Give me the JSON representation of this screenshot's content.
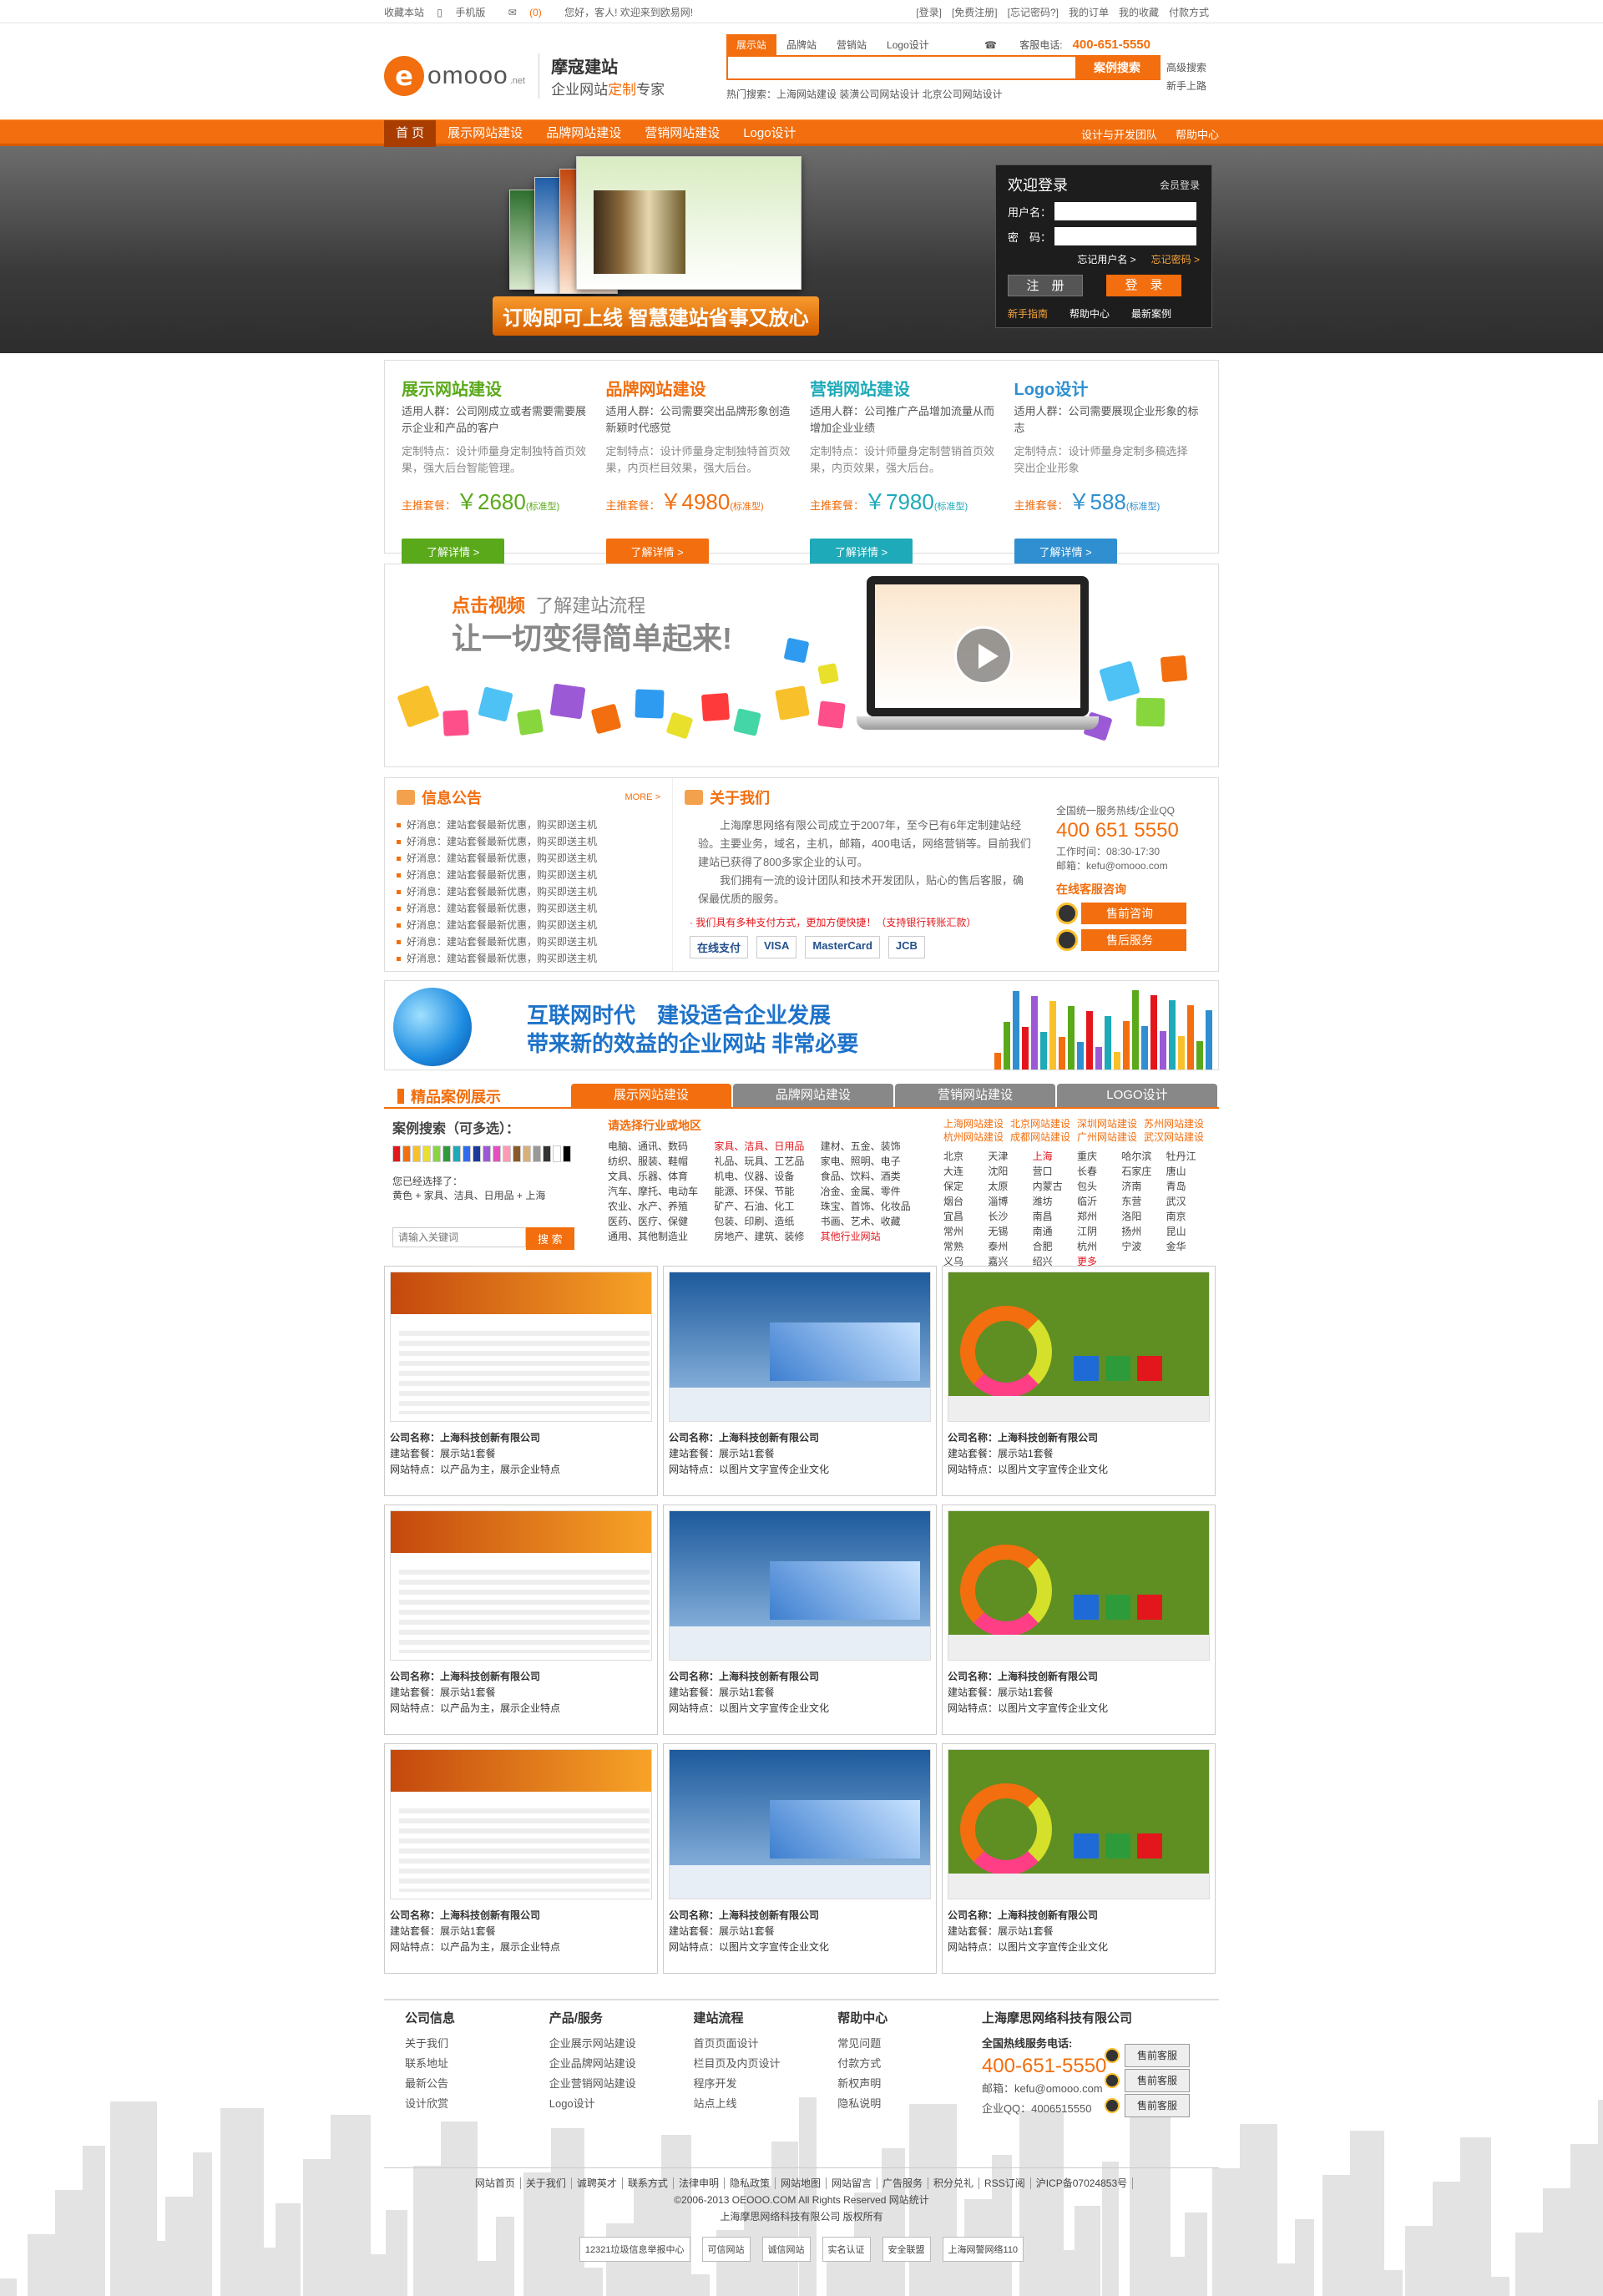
{
  "topbar": {
    "bookmark": "收藏本站",
    "mobile": "手机版",
    "msg": "(0)",
    "greeting": "您好，客人! 欢迎来到欧易网!",
    "links": [
      "[登录]",
      "[免费注册]",
      "[忘记密码?]",
      "我的订单",
      "我的收藏",
      "付款方式"
    ]
  },
  "brand": {
    "logo_letter": "e",
    "logo_word": "omooo",
    "logo_suffix": ".net",
    "slogan1": "摩寇建站",
    "slogan2a": "企业网站",
    "slogan2b": "定制",
    "slogan2c": "专家"
  },
  "search": {
    "tabs": [
      "展示站",
      "品牌站",
      "营销站",
      "Logo设计"
    ],
    "hotline_label": "客服电话:",
    "hotline": "400-651-5550",
    "placeholder": "",
    "button": "案例搜索",
    "advanced": "高级搜索",
    "newbie": "新手上路",
    "hot_words": "热门搜索：上海网站建设   装潢公司网站设计   北京公司网站设计"
  },
  "nav": {
    "items": [
      "首 页",
      "展示网站建设",
      "品牌网站建设",
      "营销网站建设",
      "Logo设计"
    ],
    "right": [
      "设计与开发团队",
      "帮助中心"
    ]
  },
  "banner": {
    "slogan": "订购即可上线 智慧建站省事又放心",
    "login": {
      "title": "欢迎登录",
      "member": "会员登录",
      "user_label": "用户名：",
      "pwd_label": "密　码：",
      "forgot_user": "忘记用户名 >",
      "forgot_pwd": "忘记密码 >",
      "register": "注　册",
      "login": "登　录",
      "guide": "新手指南",
      "help": "帮助中心",
      "latest": "最新案例"
    }
  },
  "packages": [
    {
      "title": "展示网站建设",
      "color": "#5aa91a",
      "who": "适用人群：公司刚成立或者需要需要展示企业和产品的客户",
      "feat": "定制特点：设计师量身定制独特首页效果，强大后台智能管理。",
      "label": "主推套餐：",
      "price": "￥2680",
      "std": "(标准型)",
      "btn": "了解详情 >"
    },
    {
      "title": "品牌网站建设",
      "color": "#f26e0e",
      "who": "适用人群：公司需要突出品牌形象创造新颖时代感觉",
      "feat": "定制特点：设计师量身定制独特首页效果，内页栏目效果，强大后台。",
      "label": "主推套餐：",
      "price": "￥4980",
      "std": "(标准型)",
      "btn": "了解详情 >"
    },
    {
      "title": "营销网站建设",
      "color": "#1eaab8",
      "who": "适用人群：公司推广产品增加流量从而增加企业业绩",
      "feat": "定制特点：设计师量身定制营销首页效果，内页效果，强大后台。",
      "label": "主推套餐：",
      "price": "￥7980",
      "std": "(标准型)",
      "btn": "了解详情 >"
    },
    {
      "title": "Logo设计",
      "color": "#2f8fd0",
      "who": "适用人群：公司需要展现企业形象的标志",
      "feat": "定制特点：设计师量身定制多稿选择 突出企业形象",
      "label": "主推套餐：",
      "price": "￥588",
      "std": "(标准型)",
      "btn": "了解详情 >"
    }
  ],
  "video": {
    "line1a": "点击视频",
    "line1b": "了解建站流程",
    "line2": "让一切变得简单起来!"
  },
  "notice": {
    "title": "信息公告",
    "more": "MORE >",
    "items": [
      "好消息：建站套餐最新优惠，购买即送主机",
      "好消息：建站套餐最新优惠，购买即送主机",
      "好消息：建站套餐最新优惠，购买即送主机",
      "好消息：建站套餐最新优惠，购买即送主机",
      "好消息：建站套餐最新优惠，购买即送主机",
      "好消息：建站套餐最新优惠，购买即送主机",
      "好消息：建站套餐最新优惠，购买即送主机",
      "好消息：建站套餐最新优惠，购买即送主机",
      "好消息：建站套餐最新优惠，购买即送主机"
    ]
  },
  "about": {
    "title": "关于我们",
    "p1": "上海摩思网络有限公司成立于2007年，至今已有6年定制建站经验。主要业务，域名，主机，邮箱，400电话，网络营销等。目前我们建站已获得了800多家企业的认可。",
    "p2": "我们拥有一流的设计团队和技术开发团队，贴心的售后客服，确保最优质的服务。",
    "pay_note": "· 我们具有多种支付方式，更加方便快捷！（支持银行转账汇款）",
    "pay": [
      "在线支付",
      "VISA",
      "MasterCard",
      "JCB"
    ],
    "hotline_title": "全国统一服务热线/企业QQ",
    "hotline": "400 651 5550",
    "hours": "工作时间：08:30-17:30",
    "email": "邮箱：kefu@omooo.com",
    "online": "在线客服咨询",
    "qq": [
      "售前咨询",
      "售后服务"
    ]
  },
  "strip": {
    "line1": "互联网时代　建设适合企业发展",
    "line2": "带来新的效益的企业网站 非常必要"
  },
  "cases": {
    "title": "精品案例展示",
    "tabs": [
      "展示网站建设",
      "品牌网站建设",
      "营销网站建设",
      "LOGO设计"
    ],
    "search_title": "案例搜索（可多选）：",
    "selected_label": "您已经选择了：",
    "selected": "黄色 + 家具、洁具、日用品 + 上海",
    "kw_placeholder": "请输入关键词",
    "kw_btn": "搜 索",
    "industry_title": "请选择行业或地区",
    "industries": [
      "电脑、通讯、数码",
      "家具、洁具、日用品",
      "建材、五金、装饰",
      "纺织、服装、鞋帽",
      "礼品、玩具、工艺品",
      "家电、照明、电子",
      "文具、乐器、体育",
      "机电、仪器、设备",
      "食品、饮料、酒类",
      "汽车、摩托、电动车",
      "能源、环保、节能",
      "冶金、金属、零件",
      "农业、水产、养殖",
      "矿产、石油、化工",
      "珠宝、首饰、化妆品",
      "医药、医疗、保健",
      "包装、印刷、造纸",
      "书画、艺术、收藏",
      "通用、其他制造业",
      "房地产、建筑、装修",
      "其他行业网站"
    ],
    "region_head": [
      "上海网站建设",
      "北京网站建设",
      "深圳网站建设",
      "苏州网站建设",
      "杭州网站建设",
      "成都网站建设",
      "广州网站建设",
      "武汉网站建设"
    ],
    "regions": [
      "北京",
      "天津",
      "上海",
      "重庆",
      "哈尔滨",
      "牡丹江",
      "大连",
      "沈阳",
      "营口",
      "长春",
      "石家庄",
      "唐山",
      "保定",
      "太原",
      "内蒙古",
      "包头",
      "济南",
      "青岛",
      "烟台",
      "淄博",
      "潍坊",
      "临沂",
      "东营",
      "武汉",
      "宜昌",
      "长沙",
      "南昌",
      "郑州",
      "洛阳",
      "南京",
      "常州",
      "无锡",
      "南通",
      "江阴",
      "扬州",
      "昆山",
      "常熟",
      "泰州",
      "合肥",
      "杭州",
      "宁波",
      "金华",
      "义乌",
      "嘉兴",
      "绍兴",
      "更多"
    ],
    "items": [
      {
        "company": "公司名称：上海科技创新有限公司",
        "plan": "建站套餐：展示站1套餐",
        "feature": "网站特点：以产品为主，展示企业特点",
        "style": "tpl1"
      },
      {
        "company": "公司名称：上海科技创新有限公司",
        "plan": "建站套餐：展示站1套餐",
        "feature": "网站特点：以图片文字宣传企业文化",
        "style": "tpl2"
      },
      {
        "company": "公司名称：上海科技创新有限公司",
        "plan": "建站套餐：展示站1套餐",
        "feature": "网站特点：以图片文字宣传企业文化",
        "style": "tpl3"
      },
      {
        "company": "公司名称：上海科技创新有限公司",
        "plan": "建站套餐：展示站1套餐",
        "feature": "网站特点：以产品为主，展示企业特点",
        "style": "tpl1"
      },
      {
        "company": "公司名称：上海科技创新有限公司",
        "plan": "建站套餐：展示站1套餐",
        "feature": "网站特点：以图片文字宣传企业文化",
        "style": "tpl2"
      },
      {
        "company": "公司名称：上海科技创新有限公司",
        "plan": "建站套餐：展示站1套餐",
        "feature": "网站特点：以图片文字宣传企业文化",
        "style": "tpl3"
      },
      {
        "company": "公司名称：上海科技创新有限公司",
        "plan": "建站套餐：展示站1套餐",
        "feature": "网站特点：以产品为主，展示企业特点",
        "style": "tpl1"
      },
      {
        "company": "公司名称：上海科技创新有限公司",
        "plan": "建站套餐：展示站1套餐",
        "feature": "网站特点：以图片文字宣传企业文化",
        "style": "tpl2"
      },
      {
        "company": "公司名称：上海科技创新有限公司",
        "plan": "建站套餐：展示站1套餐",
        "feature": "网站特点：以图片文字宣传企业文化",
        "style": "tpl3"
      }
    ]
  },
  "footer": {
    "cols": [
      {
        "title": "公司信息",
        "links": [
          "关于我们",
          "联系地址",
          "最新公告",
          "设计欣赏"
        ]
      },
      {
        "title": "产品/服务",
        "links": [
          "企业展示网站建设",
          "企业品牌网站建设",
          "企业营销网站建设",
          "Logo设计"
        ]
      },
      {
        "title": "建站流程",
        "links": [
          "首页页面设计",
          "栏目页及内页设计",
          "程序开发",
          "站点上线"
        ]
      },
      {
        "title": "帮助中心",
        "links": [
          "常见问题",
          "付款方式",
          "新权声明",
          "隐私说明"
        ]
      }
    ],
    "company": "上海摩思网络科技有限公司",
    "hotline_title": "全国热线服务电话:",
    "hotline": "400-651-5550",
    "email": "邮箱：kefu@omooo.com",
    "qq": "企业QQ：4006515550",
    "qq_btns": [
      "售前客服",
      "售前客服",
      "售前客服"
    ],
    "links": [
      "网站首页",
      "关于我们",
      "诚聘英才",
      "联系方式",
      "法律申明",
      "隐私政策",
      "网站地图",
      "网站留言",
      "广告服务",
      "积分兑礼",
      "RSS订阅",
      "沪ICP备07024853号"
    ],
    "copyright": "©2006-2013 OEOOO.COM All Rights Reserved   网站统计",
    "owner": "上海摩思网络科技有限公司 版权所有",
    "badges": [
      "12321垃圾信息举报中心",
      "可信网站",
      "诚信网站",
      "实名认证",
      "安全联盟",
      "上海网警网络110"
    ]
  }
}
